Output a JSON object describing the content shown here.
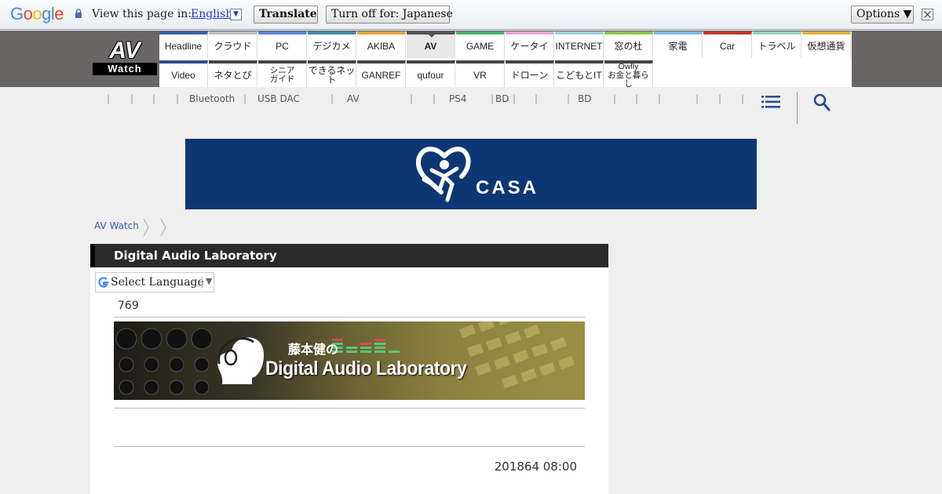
{
  "translate_bar": {
    "logo": "Google",
    "view_label": "View this page in:",
    "language": "English",
    "translate_button": "Translate",
    "turn_off_button": "Turn off for: Japanese",
    "options_button": "Options ▼"
  },
  "site": {
    "logo_main": "AV",
    "logo_sub": "Watch"
  },
  "nav": {
    "row1": [
      {
        "label": "Headline",
        "color": "#3b5fb0"
      },
      {
        "label": "クラウド",
        "color": "#bdbdbd"
      },
      {
        "label": "PC",
        "color": "#5b82d6"
      },
      {
        "label": "デジカメ",
        "color": "#3f8fa3"
      },
      {
        "label": "AKIBA",
        "color": "#e0a33a"
      },
      {
        "label": "AV",
        "color": "#555555",
        "active": true
      },
      {
        "label": "GAME",
        "color": "#43b36b"
      },
      {
        "label": "ケータイ",
        "color": "#e3a6c9"
      },
      {
        "label": "INTERNET",
        "color": "#9ad0df"
      },
      {
        "label": "窓の杜",
        "color": "#8bc34a"
      },
      {
        "label": "家電",
        "color": "#7fb6e3"
      },
      {
        "label": "Car",
        "color": "#c0392b"
      },
      {
        "label": "トラベル",
        "color": "#8fd0c4"
      },
      {
        "label": "仮想通貨",
        "color": "#e0b23a"
      }
    ],
    "row2": [
      {
        "label": "Video",
        "color": "#2c4b8a"
      },
      {
        "label": "ネタとぴ"
      },
      {
        "label": "シニア ガイド"
      },
      {
        "label": "できるネット"
      },
      {
        "label": "GANREF"
      },
      {
        "label": "qufour"
      },
      {
        "label": "VR"
      },
      {
        "label": "ドローン"
      },
      {
        "label": "こどもとIT"
      },
      {
        "label": "Owlly お金と暮らし"
      }
    ]
  },
  "sub_links": [
    "Bluetooth",
    "USB DAC",
    "AV",
    "PS4",
    "BD",
    "BD"
  ],
  "banner": {
    "brand": "CASA"
  },
  "breadcrumb": {
    "home": "AV Watch"
  },
  "article": {
    "section_title": "Digital Audio Laboratory",
    "select_language": "Select Language",
    "number": "769",
    "banner_jp": "藤本健の",
    "banner_en": "Digital Audio Laboratory",
    "date": "201864 08:00"
  }
}
